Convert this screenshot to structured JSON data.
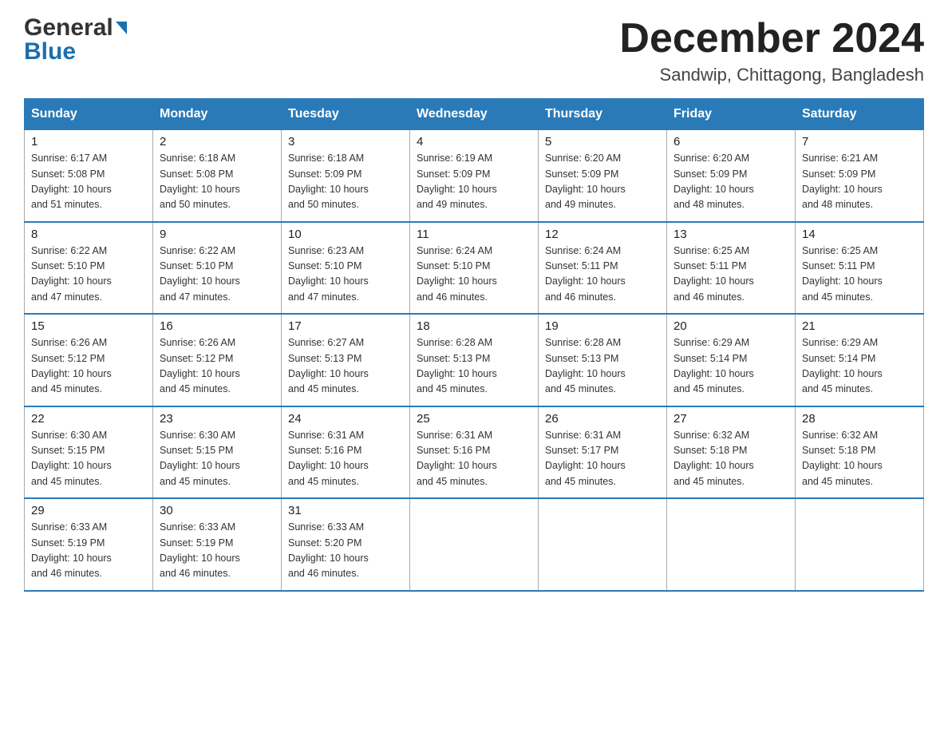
{
  "logo": {
    "row1": "General",
    "row2": "Blue"
  },
  "header": {
    "month_year": "December 2024",
    "location": "Sandwip, Chittagong, Bangladesh"
  },
  "days_of_week": [
    "Sunday",
    "Monday",
    "Tuesday",
    "Wednesday",
    "Thursday",
    "Friday",
    "Saturday"
  ],
  "weeks": [
    [
      {
        "day": "1",
        "sunrise": "6:17 AM",
        "sunset": "5:08 PM",
        "daylight": "10 hours and 51 minutes."
      },
      {
        "day": "2",
        "sunrise": "6:18 AM",
        "sunset": "5:08 PM",
        "daylight": "10 hours and 50 minutes."
      },
      {
        "day": "3",
        "sunrise": "6:18 AM",
        "sunset": "5:09 PM",
        "daylight": "10 hours and 50 minutes."
      },
      {
        "day": "4",
        "sunrise": "6:19 AM",
        "sunset": "5:09 PM",
        "daylight": "10 hours and 49 minutes."
      },
      {
        "day": "5",
        "sunrise": "6:20 AM",
        "sunset": "5:09 PM",
        "daylight": "10 hours and 49 minutes."
      },
      {
        "day": "6",
        "sunrise": "6:20 AM",
        "sunset": "5:09 PM",
        "daylight": "10 hours and 48 minutes."
      },
      {
        "day": "7",
        "sunrise": "6:21 AM",
        "sunset": "5:09 PM",
        "daylight": "10 hours and 48 minutes."
      }
    ],
    [
      {
        "day": "8",
        "sunrise": "6:22 AM",
        "sunset": "5:10 PM",
        "daylight": "10 hours and 47 minutes."
      },
      {
        "day": "9",
        "sunrise": "6:22 AM",
        "sunset": "5:10 PM",
        "daylight": "10 hours and 47 minutes."
      },
      {
        "day": "10",
        "sunrise": "6:23 AM",
        "sunset": "5:10 PM",
        "daylight": "10 hours and 47 minutes."
      },
      {
        "day": "11",
        "sunrise": "6:24 AM",
        "sunset": "5:10 PM",
        "daylight": "10 hours and 46 minutes."
      },
      {
        "day": "12",
        "sunrise": "6:24 AM",
        "sunset": "5:11 PM",
        "daylight": "10 hours and 46 minutes."
      },
      {
        "day": "13",
        "sunrise": "6:25 AM",
        "sunset": "5:11 PM",
        "daylight": "10 hours and 46 minutes."
      },
      {
        "day": "14",
        "sunrise": "6:25 AM",
        "sunset": "5:11 PM",
        "daylight": "10 hours and 45 minutes."
      }
    ],
    [
      {
        "day": "15",
        "sunrise": "6:26 AM",
        "sunset": "5:12 PM",
        "daylight": "10 hours and 45 minutes."
      },
      {
        "day": "16",
        "sunrise": "6:26 AM",
        "sunset": "5:12 PM",
        "daylight": "10 hours and 45 minutes."
      },
      {
        "day": "17",
        "sunrise": "6:27 AM",
        "sunset": "5:13 PM",
        "daylight": "10 hours and 45 minutes."
      },
      {
        "day": "18",
        "sunrise": "6:28 AM",
        "sunset": "5:13 PM",
        "daylight": "10 hours and 45 minutes."
      },
      {
        "day": "19",
        "sunrise": "6:28 AM",
        "sunset": "5:13 PM",
        "daylight": "10 hours and 45 minutes."
      },
      {
        "day": "20",
        "sunrise": "6:29 AM",
        "sunset": "5:14 PM",
        "daylight": "10 hours and 45 minutes."
      },
      {
        "day": "21",
        "sunrise": "6:29 AM",
        "sunset": "5:14 PM",
        "daylight": "10 hours and 45 minutes."
      }
    ],
    [
      {
        "day": "22",
        "sunrise": "6:30 AM",
        "sunset": "5:15 PM",
        "daylight": "10 hours and 45 minutes."
      },
      {
        "day": "23",
        "sunrise": "6:30 AM",
        "sunset": "5:15 PM",
        "daylight": "10 hours and 45 minutes."
      },
      {
        "day": "24",
        "sunrise": "6:31 AM",
        "sunset": "5:16 PM",
        "daylight": "10 hours and 45 minutes."
      },
      {
        "day": "25",
        "sunrise": "6:31 AM",
        "sunset": "5:16 PM",
        "daylight": "10 hours and 45 minutes."
      },
      {
        "day": "26",
        "sunrise": "6:31 AM",
        "sunset": "5:17 PM",
        "daylight": "10 hours and 45 minutes."
      },
      {
        "day": "27",
        "sunrise": "6:32 AM",
        "sunset": "5:18 PM",
        "daylight": "10 hours and 45 minutes."
      },
      {
        "day": "28",
        "sunrise": "6:32 AM",
        "sunset": "5:18 PM",
        "daylight": "10 hours and 45 minutes."
      }
    ],
    [
      {
        "day": "29",
        "sunrise": "6:33 AM",
        "sunset": "5:19 PM",
        "daylight": "10 hours and 46 minutes."
      },
      {
        "day": "30",
        "sunrise": "6:33 AM",
        "sunset": "5:19 PM",
        "daylight": "10 hours and 46 minutes."
      },
      {
        "day": "31",
        "sunrise": "6:33 AM",
        "sunset": "5:20 PM",
        "daylight": "10 hours and 46 minutes."
      },
      {
        "day": "",
        "sunrise": "",
        "sunset": "",
        "daylight": ""
      },
      {
        "day": "",
        "sunrise": "",
        "sunset": "",
        "daylight": ""
      },
      {
        "day": "",
        "sunrise": "",
        "sunset": "",
        "daylight": ""
      },
      {
        "day": "",
        "sunrise": "",
        "sunset": "",
        "daylight": ""
      }
    ]
  ],
  "labels": {
    "sunrise": "Sunrise:",
    "sunset": "Sunset:",
    "daylight": "Daylight:"
  }
}
